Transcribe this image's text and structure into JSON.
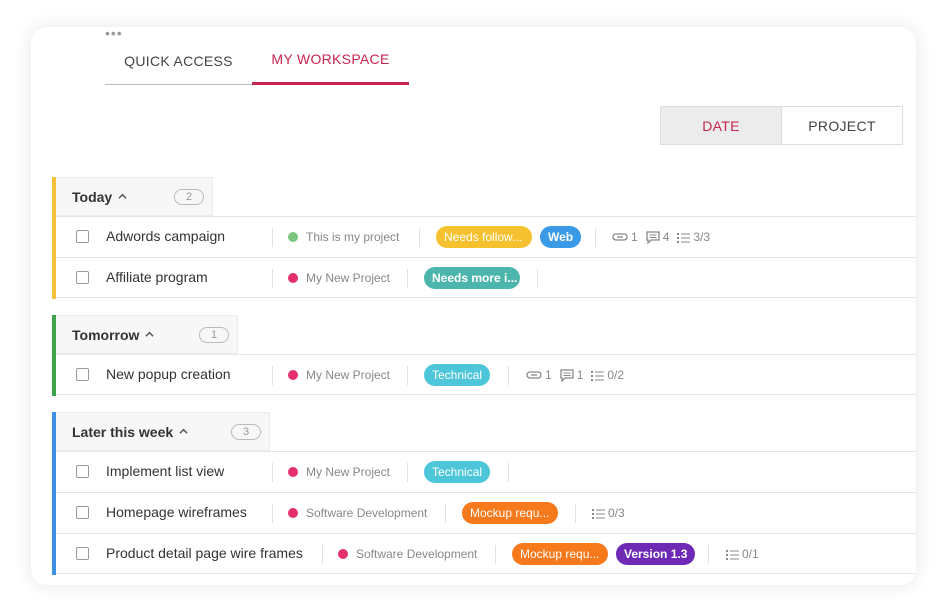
{
  "tabs": {
    "quick_access": "QUICK ACCESS",
    "my_workspace": "MY WORKSPACE",
    "more": "•••"
  },
  "view_toggle": {
    "date": "DATE",
    "project": "PROJECT",
    "active": "DATE"
  },
  "colors": {
    "accent": "#c7254e",
    "today": "#f5c13b",
    "tomorrow": "#3ea34c",
    "later": "#3d8fe0",
    "tag_yellow": "#f6c12f",
    "tag_blue": "#3b9ae8",
    "tag_teal": "#4db6ac",
    "tag_cyan": "#4ec6d9",
    "tag_orange": "#f6791c",
    "tag_purple": "#6e2ab5",
    "project_green": "#7cc47f",
    "project_pink": "#e3306a"
  },
  "groups": [
    {
      "title": "Today",
      "count": "2",
      "tasks": [
        {
          "name": "Adwords campaign",
          "project": "This is my project",
          "tags": [
            "Needs follow...",
            "Web"
          ],
          "attachments": "1",
          "comments": "4",
          "checklist": "3/3"
        },
        {
          "name": "Affiliate program",
          "project": "My New Project",
          "tags": [
            "Needs more i..."
          ]
        }
      ]
    },
    {
      "title": "Tomorrow",
      "count": "1",
      "tasks": [
        {
          "name": "New popup creation",
          "project": "My New Project",
          "tags": [
            "Technical"
          ],
          "attachments": "1",
          "comments": "1",
          "checklist": "0/2"
        }
      ]
    },
    {
      "title": "Later this week",
      "count": "3",
      "tasks": [
        {
          "name": "Implement list view",
          "project": "My New Project",
          "tags": [
            "Technical"
          ]
        },
        {
          "name": "Homepage wireframes",
          "project": "Software Development",
          "tags": [
            "Mockup requ..."
          ],
          "checklist": "0/3"
        },
        {
          "name": "Product detail page wire frames",
          "project": "Software Development",
          "tags": [
            "Mockup requ...",
            "Version 1.3"
          ],
          "checklist": "0/1"
        }
      ]
    }
  ],
  "icons": {
    "chevron": "chevron-up-icon",
    "attachment": "paperclip-icon",
    "comment": "comment-icon",
    "checklist": "checklist-icon"
  }
}
